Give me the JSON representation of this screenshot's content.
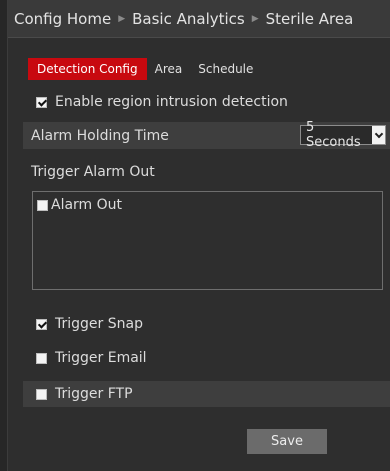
{
  "breadcrumb": {
    "items": [
      "Config Home",
      "Basic Analytics",
      "Sterile Area"
    ],
    "separator_icon": "triangle-right-icon"
  },
  "tabs": [
    {
      "label": "Detection Config",
      "active": true
    },
    {
      "label": "Area",
      "active": false
    },
    {
      "label": "Schedule",
      "active": false
    }
  ],
  "form": {
    "enable_detection": {
      "label": "Enable region intrusion detection",
      "checked": true
    },
    "alarm_holding_time": {
      "label": "Alarm Holding Time",
      "value": "5 Seconds"
    },
    "trigger_alarm_out": {
      "label": "Trigger Alarm Out",
      "items": [
        {
          "label": "Alarm Out",
          "checked": false
        }
      ]
    },
    "trigger_snap": {
      "label": "Trigger Snap",
      "checked": true
    },
    "trigger_email": {
      "label": "Trigger Email",
      "checked": false
    },
    "trigger_ftp": {
      "label": "Trigger FTP",
      "checked": false
    }
  },
  "actions": {
    "save_label": "Save"
  },
  "colors": {
    "active_tab": "#c8090f",
    "background": "#2e2e2e",
    "shaded_row": "#3e3e3e",
    "button": "#6b6b6b"
  }
}
